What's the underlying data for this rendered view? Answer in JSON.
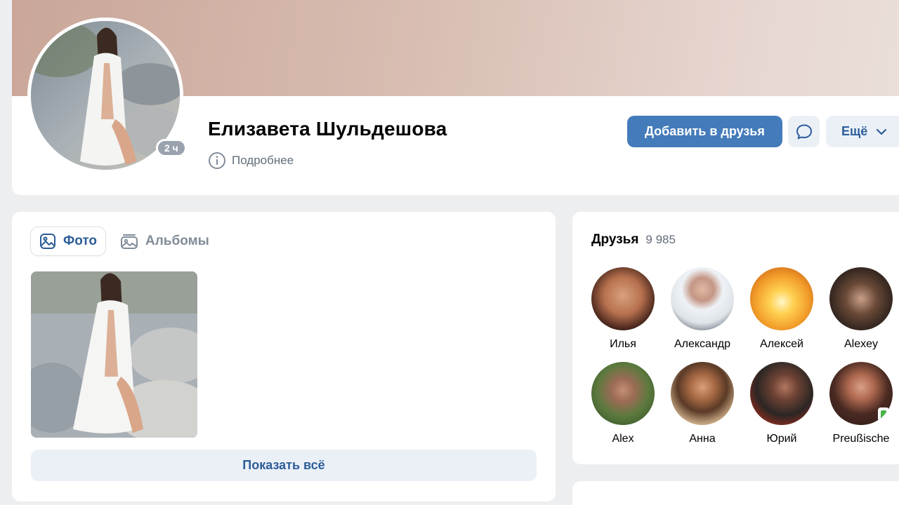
{
  "profile": {
    "name": "Елизавета Шульдешова",
    "online_status": "2 ч",
    "more_info_label": "Подробнее",
    "add_friend_label": "Добавить в друзья",
    "more_label": "Ещё",
    "avatar_icon": "profile-photo",
    "message_icon": "message-icon"
  },
  "photos": {
    "tabs": [
      {
        "label": "Фото",
        "icon": "photo-icon",
        "active": true
      },
      {
        "label": "Альбомы",
        "icon": "albums-icon",
        "active": false
      }
    ],
    "show_all_label": "Показать всё"
  },
  "friends": {
    "title": "Друзья",
    "count": "9 985",
    "items": [
      {
        "name": "Илья"
      },
      {
        "name": "Александр"
      },
      {
        "name": "Алексей"
      },
      {
        "name": "Alexey"
      },
      {
        "name": "Alex"
      },
      {
        "name": "Анна"
      },
      {
        "name": "Юрий"
      },
      {
        "name": "Preußische"
      }
    ]
  },
  "colors": {
    "accent": "#447bba",
    "accent_text": "#2c5d98",
    "background": "#edeef0",
    "secondary_button": "#ebf0f7",
    "muted_text": "#626d7a",
    "online_mobile": "#4bb34b"
  }
}
